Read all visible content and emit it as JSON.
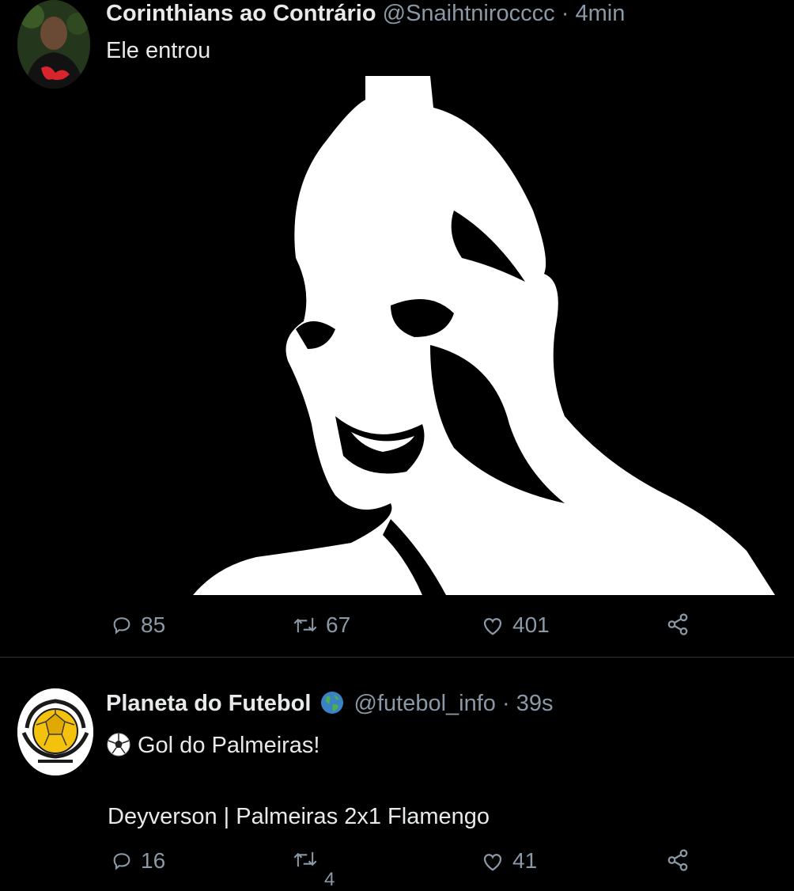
{
  "tweets": [
    {
      "author": "Corinthians ao Contrário",
      "handle": "@Snaihtnirocccc",
      "separator": "·",
      "time": "4min",
      "text": "Ele entrou",
      "replies": "85",
      "retweets": "67",
      "likes": "401",
      "icons": [
        "reply-icon",
        "retweet-icon",
        "like-icon",
        "share-icon"
      ]
    },
    {
      "author": "Planeta do Futebol",
      "handle": "@futebol_info",
      "separator": "·",
      "time": "39s",
      "text_line1": "Gol do Palmeiras!",
      "text_line2": "Deyverson | Palmeiras 2x1 Flamengo",
      "replies": "16",
      "retweets": "4",
      "likes": "41",
      "icons": [
        "globe-icon",
        "soccer-ball-icon",
        "reply-icon",
        "retweet-icon",
        "like-icon",
        "share-icon"
      ]
    }
  ],
  "colors": {
    "background": "#000000",
    "text": "#e7e9ea",
    "secondary": "#8b98a5",
    "divider": "#2f3336"
  }
}
